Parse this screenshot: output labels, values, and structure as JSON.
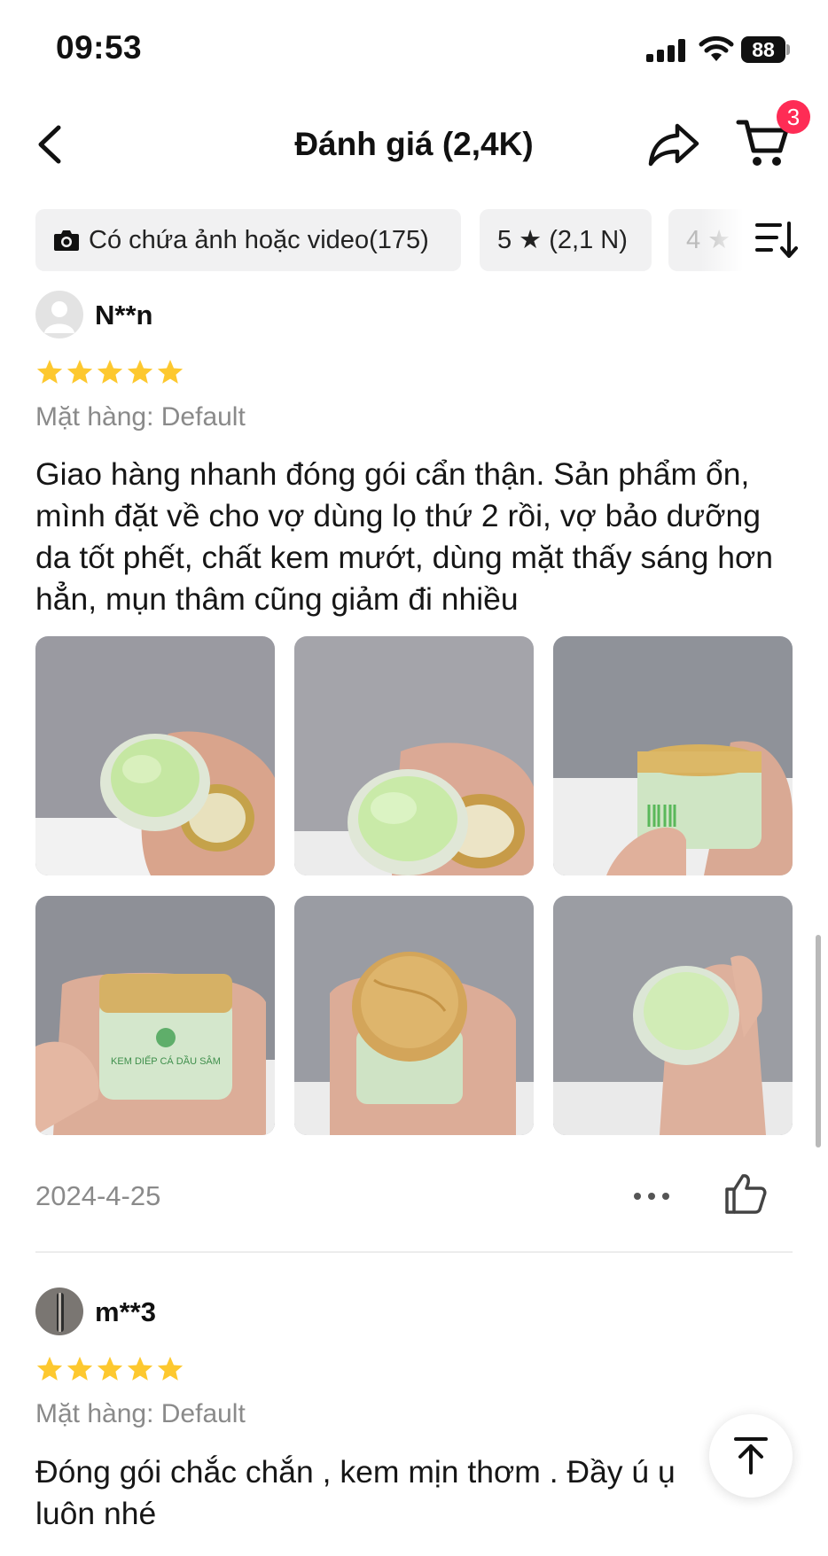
{
  "status_bar": {
    "time": "09:53",
    "battery": "88"
  },
  "header": {
    "title": "Đánh giá (2,4K)",
    "cart_count": "3"
  },
  "filters": [
    {
      "label": "Có chứa ảnh hoặc video",
      "count": "(175)"
    },
    {
      "label": "5 ★ (2,1 N)"
    },
    {
      "label": "4 ★"
    }
  ],
  "reviews": [
    {
      "username": "N**n",
      "rating": 5,
      "variant": "Mặt hàng: Default",
      "text": "Giao hàng nhanh đóng gói cẩn thận. Sản phẩm ổn, mình đặt về cho vợ dùng lọ thứ 2 rồi, vợ bảo dưỡng da tốt phết, chất kem mướt, dùng mặt thấy sáng hơn hẳn, mụn thâm cũng giảm đi nhiều",
      "photos": [
        "open-jar-cream",
        "open-jar-cream-closeup",
        "jar-label-side",
        "jar-front-label",
        "jar-bamboo-lid",
        "open-jar-tilted"
      ],
      "jar_label": "KEM DIẾP CÁ DẦU SÂM",
      "date": "2024-4-25"
    },
    {
      "username": "m**3",
      "rating": 5,
      "variant": "Mặt hàng: Default",
      "text": "Đóng gói chắc chắn , kem mịn thơm . Đầy ú ụ luôn nhé"
    }
  ],
  "colors": {
    "star": "#fdc82f",
    "badge": "#fe2c55",
    "muted_text": "#8a8a8a",
    "chip_bg": "#f1f1f2"
  },
  "icons": [
    "back-arrow-icon",
    "share-icon",
    "cart-icon",
    "camera-icon",
    "star-icon",
    "sort-icon",
    "more-icon",
    "thumbs-up-icon",
    "back-to-top-icon"
  ]
}
